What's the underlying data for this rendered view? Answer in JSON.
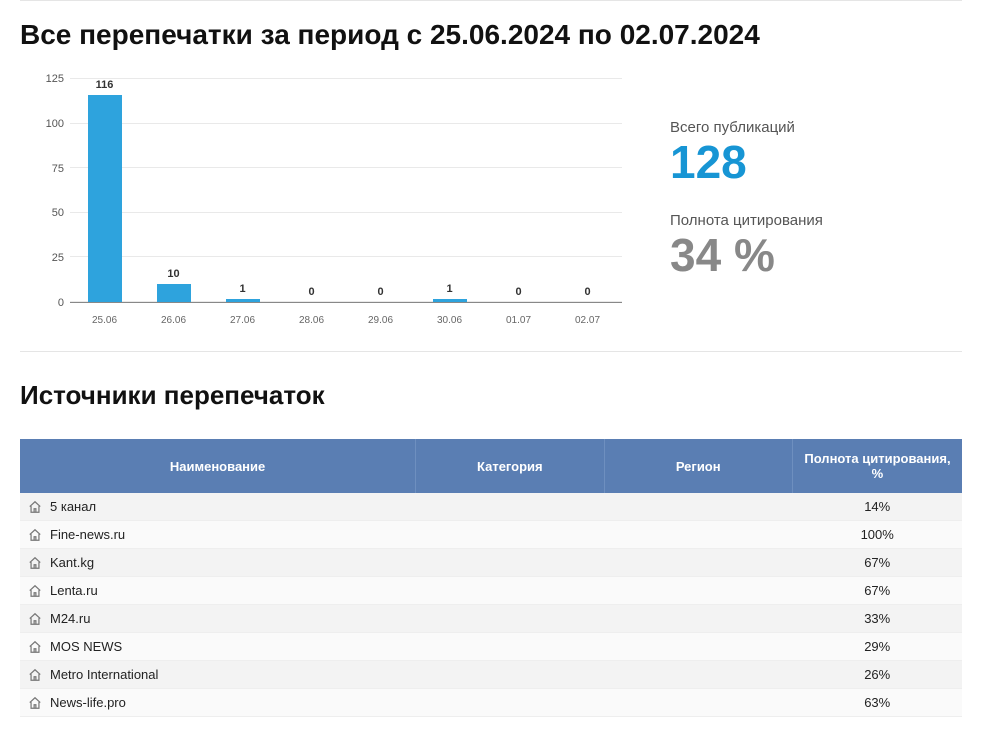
{
  "titles": {
    "page": "Все перепечатки за период с 25.06.2024 по 02.07.2024",
    "sources": "Источники перепечаток"
  },
  "stats": {
    "total_caption": "Всего публикаций",
    "total_value": "128",
    "fullness_caption": "Полнота цитирования",
    "fullness_value": "34 %"
  },
  "chart_data": {
    "type": "bar",
    "categories": [
      "25.06",
      "26.06",
      "27.06",
      "28.06",
      "29.06",
      "30.06",
      "01.07",
      "02.07"
    ],
    "values": [
      116,
      10,
      1,
      0,
      0,
      1,
      0,
      0
    ],
    "y_ticks": [
      0,
      25,
      50,
      75,
      100,
      125
    ],
    "ylim": [
      0,
      125
    ],
    "title": "",
    "xlabel": "",
    "ylabel": ""
  },
  "table": {
    "headers": {
      "name": "Наименование",
      "category": "Категория",
      "region": "Регион",
      "pct": "Полнота цитирования, %"
    },
    "rows": [
      {
        "name": "5 канал",
        "category": "",
        "region": "",
        "pct": "14%"
      },
      {
        "name": "Fine-news.ru",
        "category": "",
        "region": "",
        "pct": "100%"
      },
      {
        "name": "Kant.kg",
        "category": "",
        "region": "",
        "pct": "67%"
      },
      {
        "name": "Lenta.ru",
        "category": "",
        "region": "",
        "pct": "67%"
      },
      {
        "name": "M24.ru",
        "category": "",
        "region": "",
        "pct": "33%"
      },
      {
        "name": "MOS NEWS",
        "category": "",
        "region": "",
        "pct": "29%"
      },
      {
        "name": "Metro International",
        "category": "",
        "region": "",
        "pct": "26%"
      },
      {
        "name": "News-life.pro",
        "category": "",
        "region": "",
        "pct": "63%"
      }
    ]
  }
}
